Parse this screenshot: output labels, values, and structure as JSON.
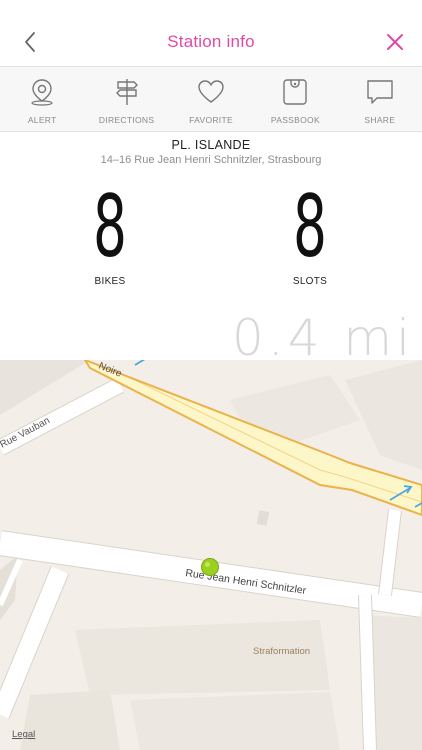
{
  "header": {
    "title": "Station info"
  },
  "toolbar": {
    "items": [
      {
        "label": "ALERT",
        "icon": "location-pin-icon"
      },
      {
        "label": "DIRECTIONS",
        "icon": "signpost-icon"
      },
      {
        "label": "FAVORITE",
        "icon": "heart-icon"
      },
      {
        "label": "PASSBOOK",
        "icon": "passbook-icon"
      },
      {
        "label": "SHARE",
        "icon": "speech-bubble-icon"
      }
    ]
  },
  "station": {
    "name": "PL. ISLANDE",
    "address": "14–16 Rue Jean Henri Schnitzler, Strasbourg",
    "bikes_count": "8",
    "bikes_label": "BIKES",
    "slots_count": "8",
    "slots_label": "SLOTS",
    "distance": "0.4 mi"
  },
  "map": {
    "street_main": "Rue Jean Henri Schnitzler",
    "street_vauban": "Rue Vauban",
    "street_noire": "Noire",
    "poi": "Straformation",
    "legal": "Legal"
  },
  "colors": {
    "accent": "#e04aa4",
    "pin": "#9bd11e",
    "highway": "#fdf6c8",
    "highway_border": "#eab24a"
  }
}
